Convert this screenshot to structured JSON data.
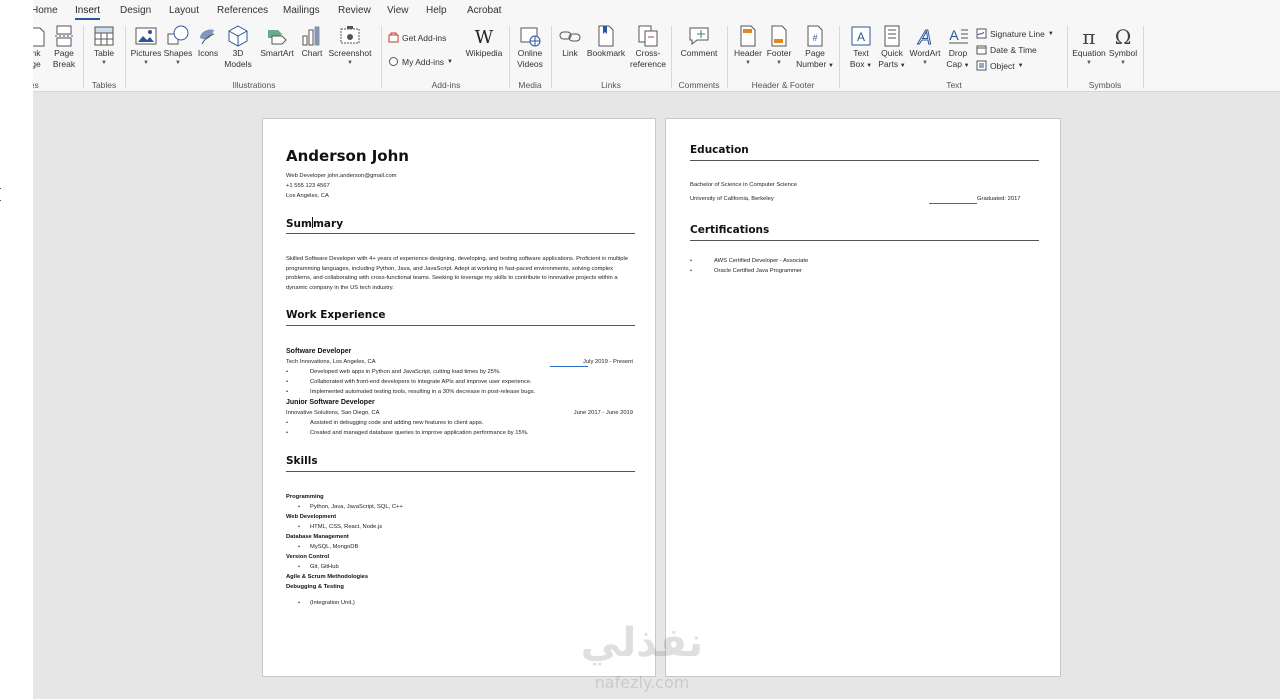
{
  "ribbon": {
    "tabs": [
      "Home",
      "Insert",
      "Design",
      "Layout",
      "References",
      "Mailings",
      "Review",
      "View",
      "Help",
      "Acrobat"
    ],
    "active_tab": "Insert",
    "groups": {
      "pages": {
        "label": "ges",
        "cmd_blank": "nk",
        "cmd_blank2": "ge",
        "cmd_break": "Page",
        "cmd_break2": "Break"
      },
      "tables": {
        "label": "Tables",
        "table": "Table"
      },
      "illustrations": {
        "label": "Illustrations",
        "pictures": "Pictures",
        "shapes": "Shapes",
        "icons": "Icons",
        "models": "3D",
        "models2": "Models",
        "smartart": "SmartArt",
        "chart": "Chart",
        "screenshot": "Screenshot"
      },
      "addins": {
        "label": "Add-ins",
        "get": "Get Add-ins",
        "my": "My Add-ins",
        "wikipedia": "Wikipedia"
      },
      "media": {
        "label": "Media",
        "online": "Online",
        "videos": "Videos"
      },
      "links": {
        "label": "Links",
        "link": "Link",
        "bookmark": "Bookmark",
        "cross": "Cross-",
        "reference": "reference"
      },
      "comments": {
        "label": "Comments",
        "comment": "Comment"
      },
      "header_footer": {
        "label": "Header & Footer",
        "header": "Header",
        "footer": "Footer",
        "page": "Page",
        "number": "Number"
      },
      "text": {
        "label": "Text",
        "textbox": "Text",
        "box": "Box",
        "quick": "Quick",
        "parts": "Parts",
        "wordart": "WordArt",
        "drop": "Drop",
        "cap": "Cap",
        "signature": "Signature Line",
        "datetime": "Date & Time",
        "object": "Object"
      },
      "symbols": {
        "label": "Symbols",
        "equation": "Equation",
        "symbol": "Symbol"
      }
    }
  },
  "resume": {
    "name": "Anderson John",
    "contact_line1": "Web Developer john.anderson@gmail.com",
    "contact_line2": "+1 555 123 4567",
    "contact_line3": "Los Angeles, CA",
    "summary_title": "Summary",
    "summary_title_a": "Sum",
    "summary_title_b": "mary",
    "summary_text": "Skilled Software Developer with 4+ years of experience designing, developing, and testing software applications. Proficient in multiple programming languages, including Python, Java, and JavaScript. Adept at working in fast-paced environments, solving complex problems, and collaborating with cross-functional teams. Seeking to leverage my skills to contribute to innovative projects within a dynamic company in the US tech industry.",
    "work_title": "Work Experience",
    "jobs": [
      {
        "title": "Software Developer",
        "company": "Tech Innovations, Los Angeles, CA",
        "dates": "July 2019 - Present",
        "bullets": [
          "Developed web apps in Python and JavaScript, cutting load times by 25%.",
          "Collaborated with front-end developers to integrate APIs and improve user experience.",
          "Implemented automated testing tools, resulting in a 30% decrease in post-release bugs."
        ]
      },
      {
        "title": "Junior Software Developer",
        "company": "Innovative Solutions, San Diego, CA",
        "dates": "June 2017 - June 2019",
        "bullets": [
          "Assisted in debugging code and adding new features to client apps.",
          "Created and managed database queries to improve application performance by 15%."
        ]
      }
    ],
    "skills_title": "Skills",
    "skills": [
      {
        "head": "Programming",
        "item": "Python, Java, JavaScript, SQL, C++"
      },
      {
        "head": "Web Development",
        "item": "HTML, CSS, React, Node.js"
      },
      {
        "head": "Database Management",
        "item": "MySQL, MongoDB"
      },
      {
        "head": "Version Control",
        "item": "Git, GitHub"
      },
      {
        "head": "Agile & Scrum Methodologies",
        "item": ""
      },
      {
        "head": "Debugging & Testing",
        "item": "(Integration Unit,)"
      }
    ],
    "education_title": "Education",
    "degree": "Bachelor of Science in Computer Science",
    "university": "University of California, Berkeley",
    "graduated": "Graduated: 2017",
    "certifications_title": "Certifications",
    "certifications": [
      "AWS Certified Developer - Associate",
      "Oracle Certified Java Programmer"
    ]
  },
  "colors": {
    "accent": "#2b579a",
    "canvas": "#e6e6e6",
    "ribbon": "#f7f7f7"
  },
  "watermark": {
    "arabic": "نفذلي",
    "latin": "nafezly.com"
  }
}
